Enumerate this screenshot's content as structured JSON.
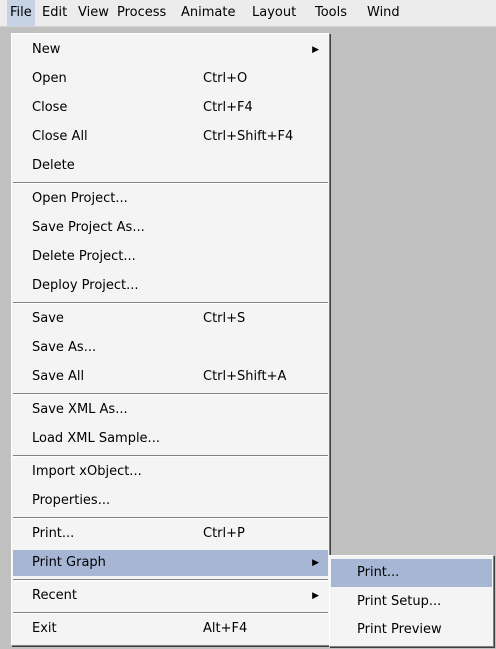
{
  "menubar": {
    "items": [
      "File",
      "Edit",
      "View",
      "Process",
      "Animate",
      "Layout",
      "Tools",
      "Wind"
    ]
  },
  "file_menu": {
    "items": [
      {
        "label": "New",
        "shortcut": "",
        "submenu": true
      },
      {
        "label": "Open",
        "shortcut": "Ctrl+O"
      },
      {
        "label": "Close",
        "shortcut": "Ctrl+F4"
      },
      {
        "label": "Close All",
        "shortcut": "Ctrl+Shift+F4"
      },
      {
        "label": "Delete",
        "shortcut": ""
      },
      {
        "label": "Open Project...",
        "shortcut": ""
      },
      {
        "label": "Save Project As...",
        "shortcut": ""
      },
      {
        "label": "Delete Project...",
        "shortcut": ""
      },
      {
        "label": "Deploy Project...",
        "shortcut": ""
      },
      {
        "label": "Save",
        "shortcut": "Ctrl+S"
      },
      {
        "label": "Save As...",
        "shortcut": ""
      },
      {
        "label": "Save All",
        "shortcut": "Ctrl+Shift+A"
      },
      {
        "label": "Save XML As...",
        "shortcut": ""
      },
      {
        "label": "Load XML Sample...",
        "shortcut": ""
      },
      {
        "label": "Import xObject...",
        "shortcut": ""
      },
      {
        "label": "Properties...",
        "shortcut": ""
      },
      {
        "label": "Print...",
        "shortcut": "Ctrl+P"
      },
      {
        "label": "Print Graph",
        "shortcut": "",
        "submenu": true
      },
      {
        "label": "Recent",
        "shortcut": "",
        "submenu": true
      },
      {
        "label": "Exit",
        "shortcut": "Alt+F4"
      }
    ]
  },
  "print_graph_submenu": {
    "items": [
      "Print...",
      "Print Setup...",
      "Print Preview"
    ]
  },
  "colors": {
    "highlight": "#a6b6d4",
    "canvas": "#c0c0c0"
  }
}
